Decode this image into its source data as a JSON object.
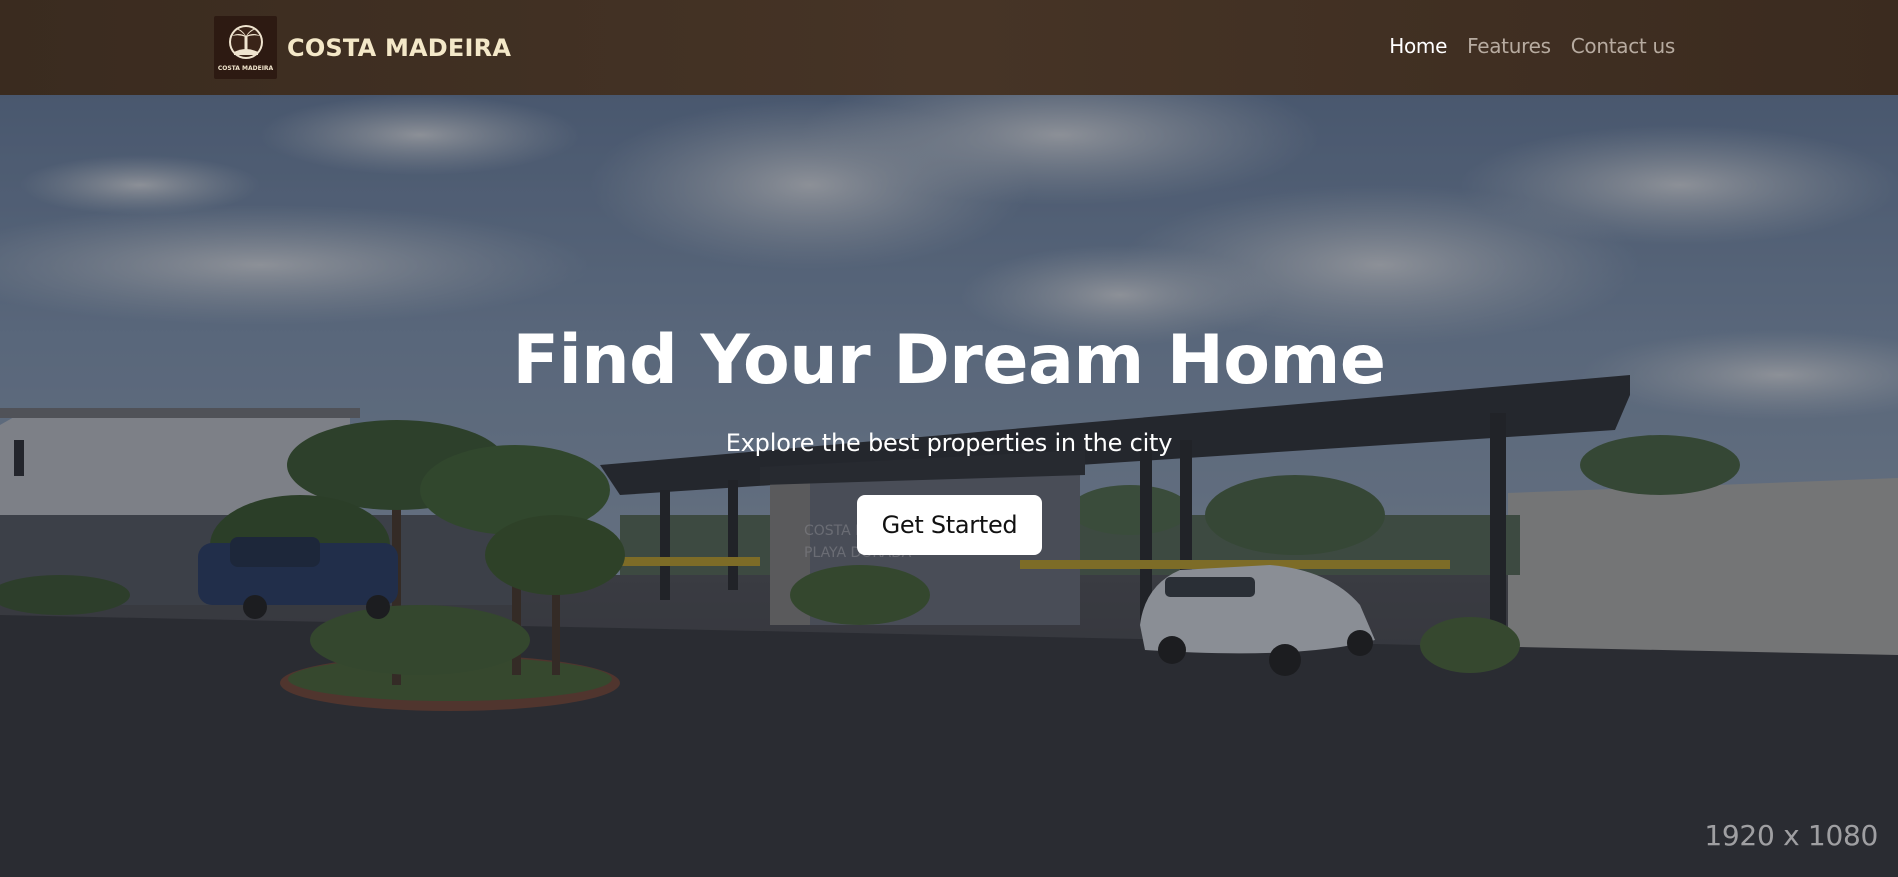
{
  "brand": {
    "name": "COSTA MADEIRA",
    "logo_text": "COSTA MADEIRA",
    "logo_icon": "palm-tree-emblem-icon"
  },
  "nav": {
    "items": [
      {
        "label": "Home",
        "active": true
      },
      {
        "label": "Features",
        "active": false
      },
      {
        "label": "Contact us",
        "active": false
      }
    ]
  },
  "hero": {
    "title": "Find Your Dream Home",
    "subtitle": "Explore the best properties in the city",
    "cta_label": "Get Started",
    "resolution_label": "1920 x 1080",
    "scene_sign": [
      "COSTA M",
      "PLAYA DORADA"
    ]
  },
  "colors": {
    "navbar": "#3b2b1f",
    "brand_text": "#f4e8c8",
    "nav_active": "#ffffff",
    "nav_inactive": "#b7aba0",
    "cta_background": "#ffffff"
  }
}
